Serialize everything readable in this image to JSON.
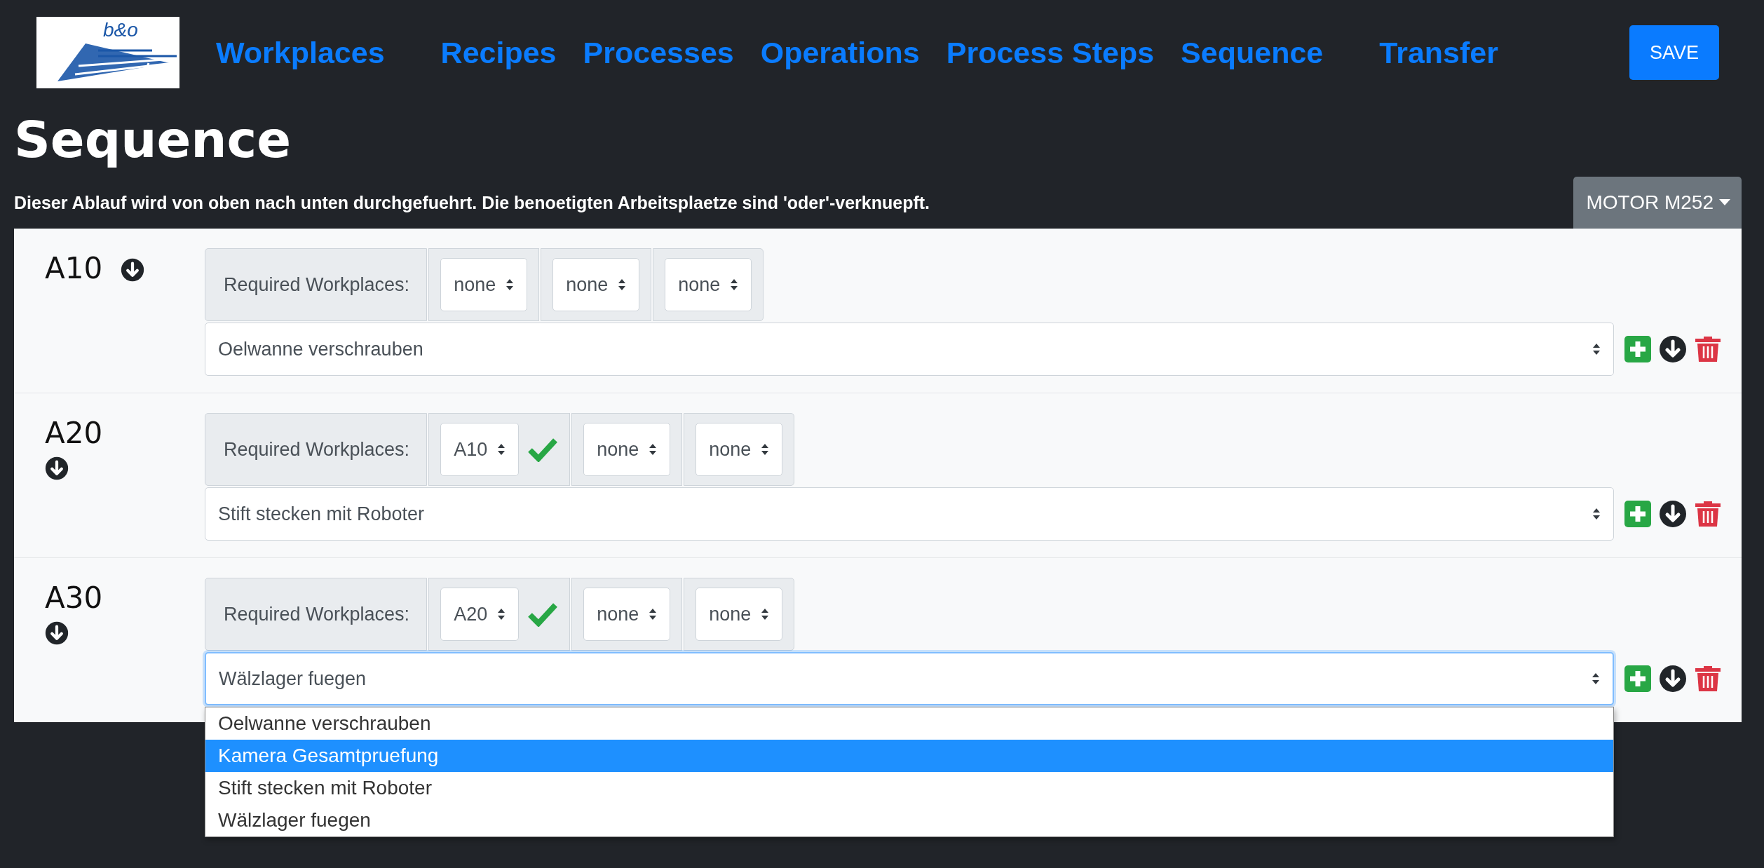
{
  "logo": {
    "text": "b&o"
  },
  "nav": {
    "links": [
      "Workplaces",
      "Recipes",
      "Processes",
      "Operations",
      "Process Steps",
      "Sequence",
      "Transfer"
    ],
    "save": "SAVE"
  },
  "title": "Sequence",
  "description": "Dieser Ablauf wird von oben nach unten durchgefuehrt. Die benoetigten Arbeitsplaetze sind 'oder'-verknuepft.",
  "product_selector": {
    "label": "MOTOR M252"
  },
  "steps": [
    {
      "name": "A10",
      "arrow_beside": true,
      "required_label": "Required Workplaces:",
      "workplaces": [
        {
          "value": "none",
          "confirmed": false
        },
        {
          "value": "none",
          "confirmed": false
        },
        {
          "value": "none",
          "confirmed": false
        }
      ],
      "operation": "Oelwanne verschrauben",
      "focused": false
    },
    {
      "name": "A20",
      "arrow_beside": false,
      "required_label": "Required Workplaces:",
      "workplaces": [
        {
          "value": "A10",
          "confirmed": true
        },
        {
          "value": "none",
          "confirmed": false
        },
        {
          "value": "none",
          "confirmed": false
        }
      ],
      "operation": "Stift stecken mit Roboter",
      "focused": false
    },
    {
      "name": "A30",
      "arrow_beside": false,
      "required_label": "Required Workplaces:",
      "workplaces": [
        {
          "value": "A20",
          "confirmed": true
        },
        {
          "value": "none",
          "confirmed": false
        },
        {
          "value": "none",
          "confirmed": false
        }
      ],
      "operation": "Wälzlager fuegen",
      "focused": true,
      "dropdown": [
        {
          "label": "Oelwanne verschrauben",
          "highlighted": false
        },
        {
          "label": "Kamera Gesamtpruefung",
          "highlighted": true
        },
        {
          "label": "Stift stecken mit Roboter",
          "highlighted": false
        },
        {
          "label": "Wälzlager fuegen",
          "highlighted": false
        }
      ]
    }
  ]
}
